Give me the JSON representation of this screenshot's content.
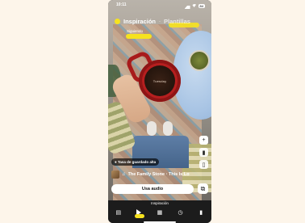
{
  "status_bar": {
    "time": "10:11",
    "battery": "84"
  },
  "header": {
    "active_tab": "Inspiración",
    "separator": "·",
    "inactive_tab": "Plantillas",
    "subtitle": "Siguiendo"
  },
  "media": {
    "mug_text": "Tuesday"
  },
  "badge": {
    "label": "Tasa de guardado alta"
  },
  "audio": {
    "note_glyph": "♫",
    "track": "The Family Stone · This Is Lo"
  },
  "cta": {
    "use_audio": "Usa audio"
  },
  "nav": {
    "label": "Inspiración",
    "items": [
      {
        "name": "stories",
        "glyph": "▤"
      },
      {
        "name": "inspiracion",
        "glyph": "▶"
      },
      {
        "name": "grid",
        "glyph": "▦"
      },
      {
        "name": "clock",
        "glyph": "◷"
      },
      {
        "name": "insights",
        "glyph": "▮"
      }
    ]
  },
  "tools": {
    "plus": "+",
    "chart": "▮",
    "bookmark": "▯"
  },
  "highlight_color": "#f6e21f"
}
